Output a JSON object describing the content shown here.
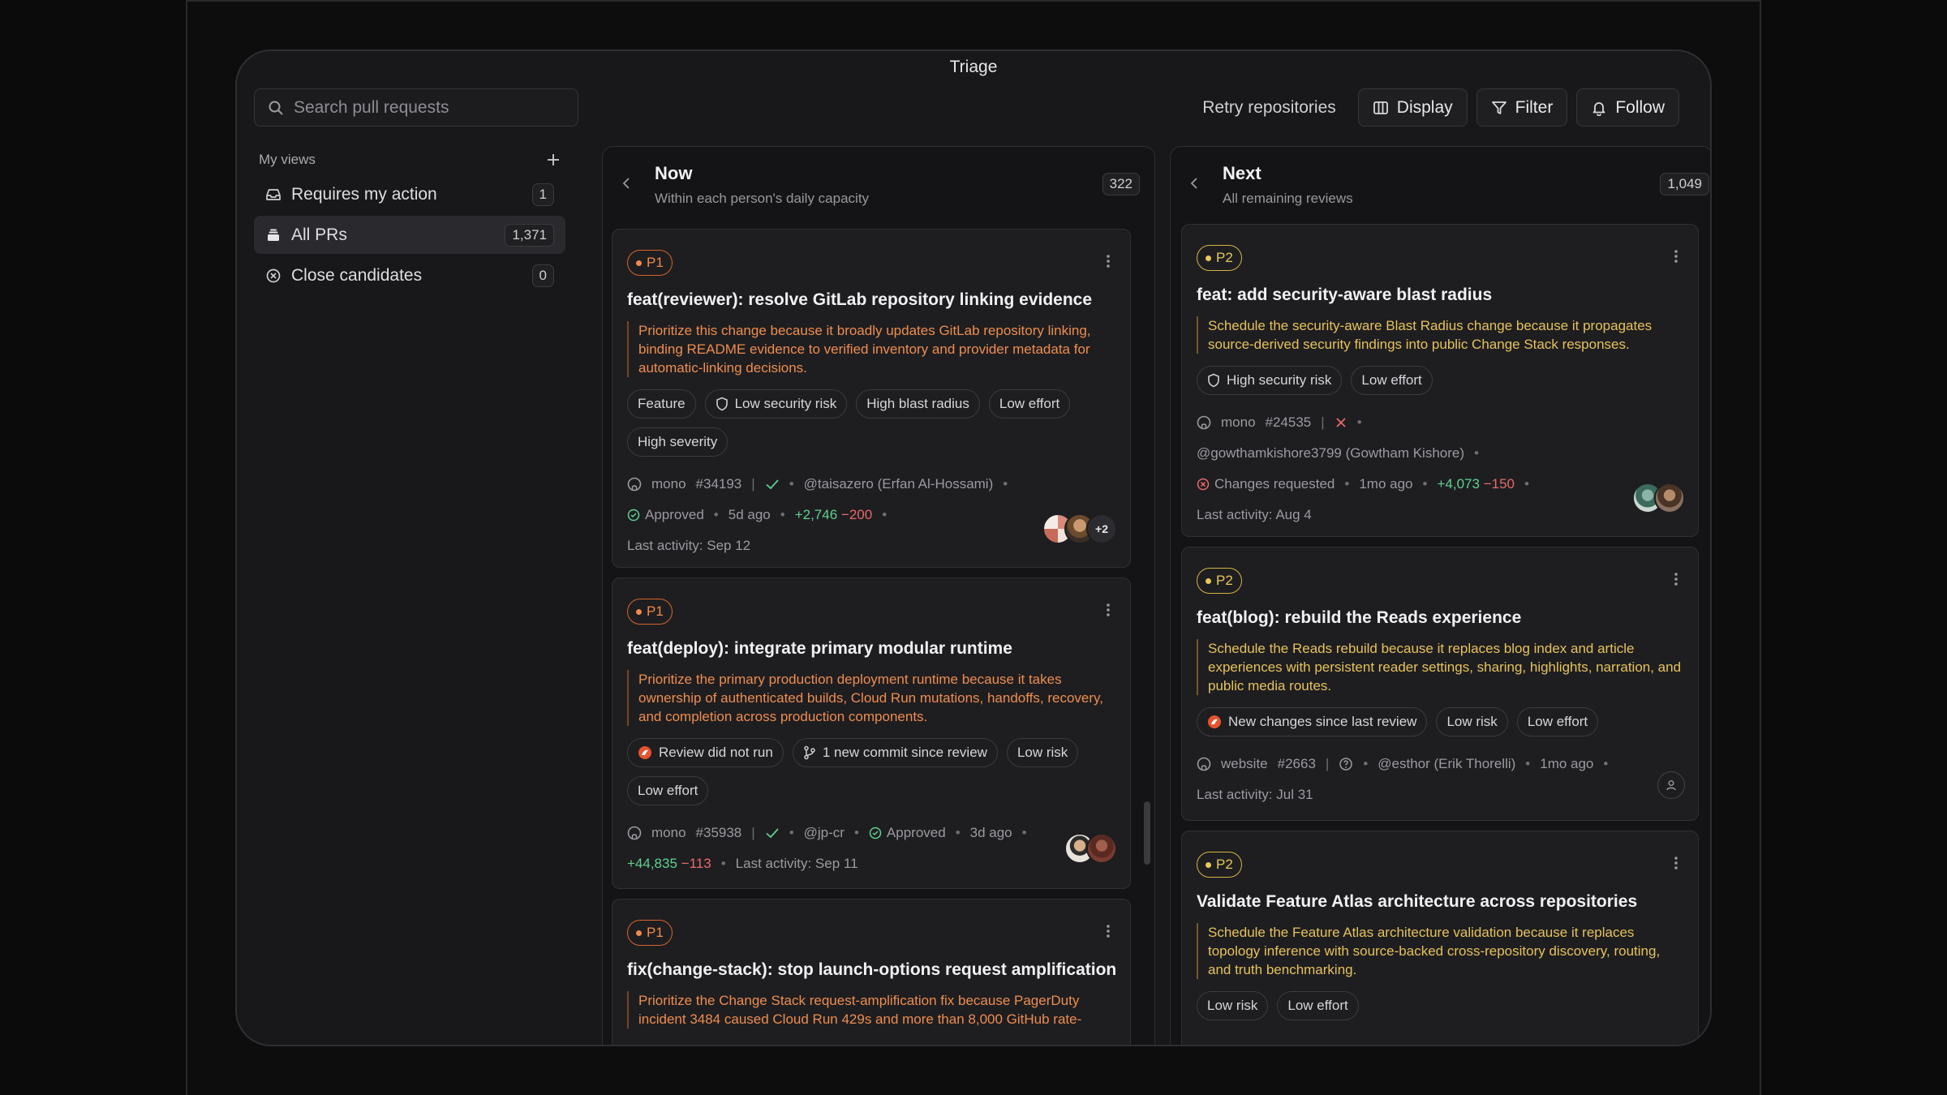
{
  "window": {
    "title": "Triage"
  },
  "search": {
    "placeholder": "Search pull requests"
  },
  "toolbar": {
    "retry": "Retry repositories",
    "display": "Display",
    "filter": "Filter",
    "follow": "Follow"
  },
  "sidebar": {
    "heading": "My views",
    "items": [
      {
        "label": "Requires my action",
        "count": "1"
      },
      {
        "label": "All PRs",
        "count": "1,371"
      },
      {
        "label": "Close candidates",
        "count": "0"
      }
    ]
  },
  "columns": {
    "now": {
      "title": "Now",
      "subtitle": "Within each person's daily capacity",
      "count": "322",
      "cards": [
        {
          "priority": "P1",
          "title": "feat(reviewer): resolve GitLab repository linking evidence",
          "reason": "Prioritize this change because it broadly updates GitLab repository linking, binding README evidence to verified inventory and provider metadata for automatic-linking decisions.",
          "tags": [
            "Feature",
            "Low security risk",
            "High blast radius",
            "Low effort",
            "High severity"
          ],
          "repo": "mono",
          "number": "#34193",
          "author": "@taisazero (Erfan Al-Hossami)",
          "status": "Approved",
          "age": "5d ago",
          "additions": "+2,746",
          "deletions": "−200",
          "last_activity": "Last activity: Sep 12",
          "more": "+2"
        },
        {
          "priority": "P1",
          "title": "feat(deploy): integrate primary modular runtime",
          "reason": "Prioritize the primary production deployment runtime because it takes ownership of authenticated builds, Cloud Run mutations, handoffs, recovery, and completion across production components.",
          "tags": [
            "Review did not run",
            "1 new commit since review",
            "Low risk",
            "Low effort"
          ],
          "repo": "mono",
          "number": "#35938",
          "author": "@jp-cr",
          "status": "Approved",
          "age": "3d ago",
          "additions": "+44,835",
          "deletions": "−113",
          "last_activity": "Last activity: Sep 11"
        },
        {
          "priority": "P1",
          "title": "fix(change-stack): stop launch-options request amplification",
          "reason": "Prioritize the Change Stack request-amplification fix because PagerDuty incident 3484 caused Cloud Run 429s and more than 8,000 GitHub rate-"
        }
      ]
    },
    "next": {
      "title": "Next",
      "subtitle": "All remaining reviews",
      "count": "1,049",
      "cards": [
        {
          "priority": "P2",
          "title": "feat: add security-aware blast radius",
          "reason": "Schedule the security-aware Blast Radius change because it propagates source-derived security findings into public Change Stack responses.",
          "tags": [
            "High security risk",
            "Low effort"
          ],
          "repo": "mono",
          "number": "#24535",
          "author": "@gowthamkishore3799 (Gowtham Kishore)",
          "status": "Changes requested",
          "age": "1mo ago",
          "additions": "+4,073",
          "deletions": "−150",
          "last_activity": "Last activity: Aug 4"
        },
        {
          "priority": "P2",
          "title": "feat(blog): rebuild the Reads experience",
          "reason": "Schedule the Reads rebuild because it replaces blog index and article experiences with persistent reader settings, sharing, highlights, narration, and public media routes.",
          "tags": [
            "New changes since last review",
            "Low risk",
            "Low effort"
          ],
          "repo": "website",
          "number": "#2663",
          "author": "@esthor (Erik Thorelli)",
          "age": "1mo ago",
          "last_activity": "Last activity: Jul 31"
        },
        {
          "priority": "P2",
          "title": "Validate Feature Atlas architecture across repositories",
          "reason": "Schedule the Feature Atlas architecture validation because it replaces topology inference with source-backed cross-repository discovery, routing, and truth benchmarking.",
          "tags": [
            "Low risk",
            "Low effort"
          ]
        }
      ]
    }
  },
  "colors": {
    "p1": "#f08a4b",
    "p2": "#e9c85a",
    "additions": "#5fd08f",
    "deletions": "#e86a6a"
  }
}
